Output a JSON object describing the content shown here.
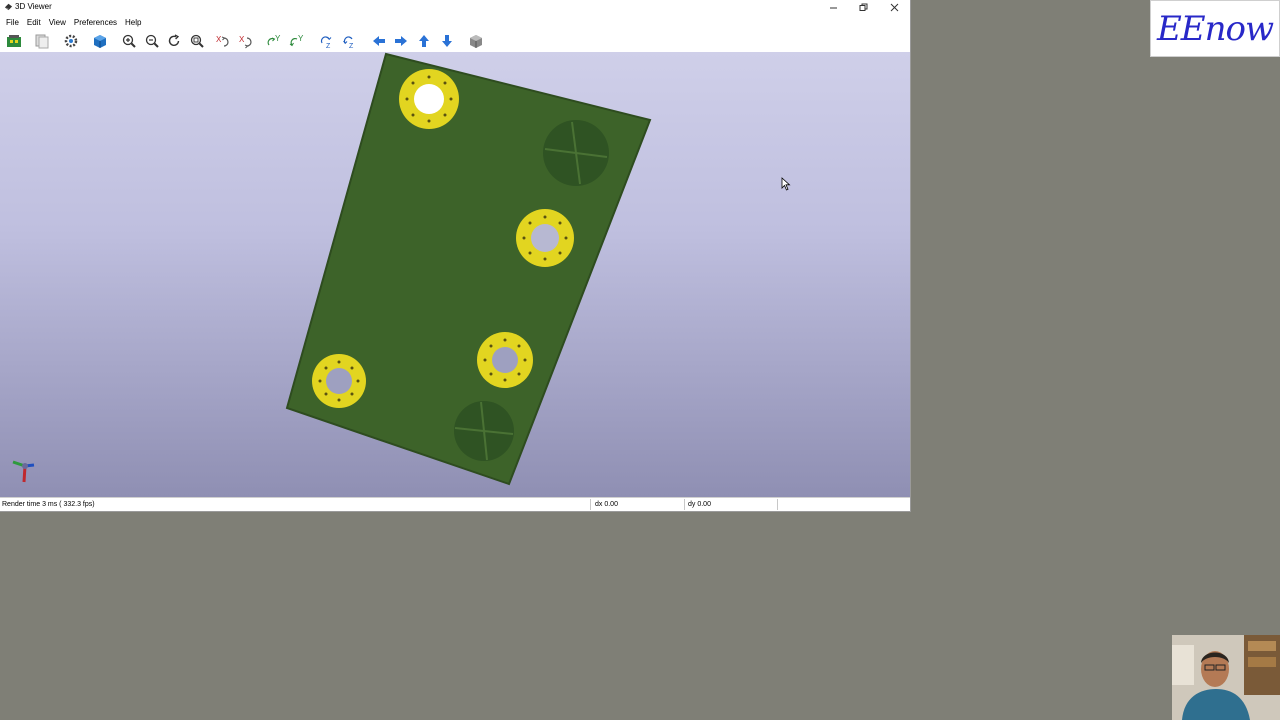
{
  "window": {
    "title": "3D Viewer",
    "controls": [
      "minimize",
      "maximize",
      "close"
    ]
  },
  "menu": {
    "items": [
      "File",
      "Edit",
      "View",
      "Preferences",
      "Help"
    ]
  },
  "toolbar": {
    "buttons": [
      "reload-board-icon",
      "copy-image-icon",
      "render-options-icon",
      "raytrace-icon",
      "zoom-in-icon",
      "zoom-out-icon",
      "redraw-icon",
      "zoom-fit-icon",
      "rotate-x-cw-icon",
      "rotate-x-ccw-icon",
      "rotate-y-cw-icon",
      "rotate-y-ccw-icon",
      "rotate-z-cw-icon",
      "rotate-z-ccw-icon",
      "pan-left-icon",
      "pan-right-icon",
      "pan-up-icon",
      "pan-down-icon",
      "ortho-toggle-icon"
    ]
  },
  "status": {
    "render_time": "Render time 3 ms ( 332.3 fps)",
    "dx": "dx 0.00",
    "dy": "dy 0.00"
  },
  "colors": {
    "board": "#3d6329",
    "board_edge": "#2e4c1f",
    "pad": "#e2d520",
    "hole": "#b7b8d2",
    "viewport_top": "#cfcfe9",
    "viewport_bottom": "#8f8fb3"
  },
  "overlay": {
    "logo_text": "EEnow"
  }
}
